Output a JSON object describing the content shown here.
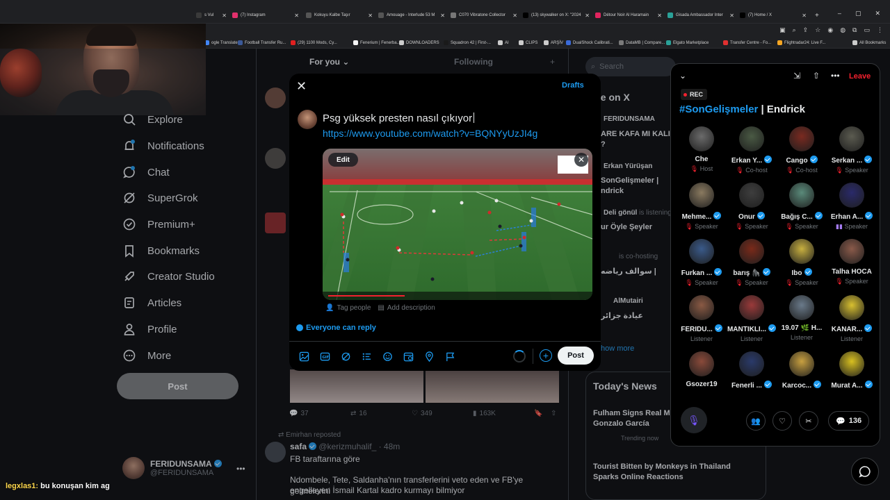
{
  "browser": {
    "tabs": [
      {
        "label": "s Vul",
        "color": "#3a3a3a"
      },
      {
        "label": "(7) Instagram",
        "color": "#e1306c"
      },
      {
        "label": "Kokuyu Kalbe Taşır",
        "color": "#555555"
      },
      {
        "label": "Amouage - Interlude 53 M",
        "color": "#555555"
      },
      {
        "label": "C070 Vibratone Collector",
        "color": "#777777"
      },
      {
        "label": "(13) skywalker on X: \"2024",
        "color": "#000000"
      },
      {
        "label": "Détour Noir Al Haramain",
        "color": "#e0245e"
      },
      {
        "label": "Gisada Ambassador Inter",
        "color": "#2aa198"
      },
      {
        "label": "(7) Home / X",
        "color": "#000000"
      }
    ],
    "bookmarks": [
      "ogle Translate",
      "Football Transfer Ru...",
      "(29) 1100 Mods, Cy...",
      "Fenerium | Fenerba...",
      "DOWNLOADERS",
      "Squadron 42 | First-...",
      "AI",
      "CLIPS",
      "ARŞİV",
      "DualShock Calibrati...",
      "DataMB | Compare...",
      "Elgato Marketplace",
      "Transfer Centre - Fo...",
      "Flightradar24: Live F...",
      "All Bookmarks"
    ]
  },
  "nav": {
    "items": [
      {
        "id": "explore",
        "label": "Explore"
      },
      {
        "id": "notifications",
        "label": "Notifications"
      },
      {
        "id": "chat",
        "label": "Chat"
      },
      {
        "id": "supergrok",
        "label": "SuperGrok"
      },
      {
        "id": "premium",
        "label": "Premium+"
      },
      {
        "id": "bookmarks",
        "label": "Bookmarks"
      },
      {
        "id": "creator",
        "label": "Creator Studio"
      },
      {
        "id": "articles",
        "label": "Articles"
      },
      {
        "id": "profile",
        "label": "Profile"
      },
      {
        "id": "more",
        "label": "More"
      }
    ],
    "post_label": "Post",
    "account_name": "FERIDUNSAMA",
    "account_handle": "@FERIDUNSAMA"
  },
  "feed": {
    "tab_for_you": "For you",
    "tab_following": "Following",
    "actions": {
      "replies": "37",
      "reposts": "16",
      "likes": "349",
      "views": "163K"
    },
    "reposted_by": "Emirhan reposted",
    "tweet2_name": "safa",
    "tweet2_handle": "@kerizmuhalif_ · 48m",
    "tweet2_line1": "FB taraftarına göre",
    "tweet2_line2": "Ndombele, Tete, Saldanha'nın transferlerini veto eden ve FB'ye gelmelerini",
    "tweet2_line3": "engelleyen İsmail Kartal kadro kurmayı bilmiyor"
  },
  "right": {
    "search_placeholder": "Search",
    "live_title": "ve on X",
    "live_1_name": "FERIDUNSAMA",
    "live_1_text": "ARE KAFA MI KALIN",
    "live_1_text2": "?",
    "live_2_name": "Erkan Yürüşan",
    "live_2_text": "SonGelişmeler |",
    "live_2_text2": "ndrick",
    "live_3_name": "Deli gönül",
    "live_3_status": "is listening",
    "live_3_text": "ur Öyle Şeyler",
    "live_4_status": "is co-hosting",
    "live_4_text": "سوالف رياضه |",
    "live_5_name": "AlMutairi",
    "live_5_text": "عيادة جزائر",
    "show_more": "how more",
    "news_title": "Today's News",
    "news_1": "Fulham Signs Real M",
    "news_1b": "Gonzalo García",
    "news_1_meta": "Trending now",
    "news_2": "Tourist Bitten by Monkeys in Thailand",
    "news_2b": "Sparks Online Reactions"
  },
  "compose": {
    "drafts_label": "Drafts",
    "text": "Psg yüksek presten nasıl çıkıyor",
    "link": "https://www.youtube.com/watch?v=BQNYyUzJI4g",
    "edit_label": "Edit",
    "tag_people": "Tag people",
    "add_description": "Add description",
    "reply_setting": "Everyone can reply",
    "post_label": "Post"
  },
  "space": {
    "rec_label": "REC",
    "hashtag": "#SonGelişmeler",
    "title_rest": " | Endrick",
    "leave_label": "Leave",
    "comments_count": "136",
    "speakers": [
      {
        "name": "Che",
        "role": "Host",
        "verified": false,
        "color": "#6b6b6b"
      },
      {
        "name": "Erkan Y...",
        "role": "Co-host",
        "verified": true,
        "color": "#4a5a44"
      },
      {
        "name": "Cango",
        "role": "Co-host",
        "verified": true,
        "color": "#7a2a20"
      },
      {
        "name": "Serkan ...",
        "role": "Speaker",
        "verified": true,
        "color": "#5b5b50"
      },
      {
        "name": "Mehme...",
        "role": "Speaker",
        "verified": true,
        "color": "#8a7a60"
      },
      {
        "name": "Onur",
        "role": "Speaker",
        "verified": true,
        "color": "#3e3e3e"
      },
      {
        "name": "Bağış C...",
        "role": "Speaker",
        "verified": true,
        "color": "#5a8a7a"
      },
      {
        "name": "Erhan A...",
        "role": "Speaker",
        "verified": true,
        "color": "#2a2a6a"
      },
      {
        "name": "Furkan ...",
        "role": "Speaker",
        "verified": true,
        "color": "#3a5a8a"
      },
      {
        "name": "barış 🦍",
        "role": "Speaker",
        "verified": true,
        "color": "#7a2a1a"
      },
      {
        "name": "Ibo",
        "role": "Speaker",
        "verified": true,
        "color": "#c8b040"
      },
      {
        "name": "Talha HOCA",
        "role": "Speaker",
        "verified": false,
        "color": "#8a5a4a"
      },
      {
        "name": "FERIDU...",
        "role": "Listener",
        "verified": true,
        "color": "#8a5a44"
      },
      {
        "name": "MANTIKLI...",
        "role": "Listener",
        "verified": true,
        "color": "#9a3a3a"
      },
      {
        "name": "19.07 🌿 H...",
        "role": "Listener",
        "verified": false,
        "color": "#6a7a8a"
      },
      {
        "name": "KANAR...",
        "role": "Listener",
        "verified": true,
        "color": "#d8c030"
      },
      {
        "name": "Gsozer19",
        "role": "",
        "verified": false,
        "color": "#8a4a3a"
      },
      {
        "name": "Fenerli ...",
        "role": "",
        "verified": true,
        "color": "#2a3a6a"
      },
      {
        "name": "Karcoc...",
        "role": "",
        "verified": true,
        "color": "#c8a040"
      },
      {
        "name": "Murat A...",
        "role": "",
        "verified": true,
        "color": "#d8c020"
      }
    ]
  },
  "chat_overlay": {
    "user": "legxlas1:",
    "message": "bu konuşan kim ag"
  },
  "colors": {
    "accent": "#1d9bf0",
    "danger": "#f4212e",
    "background": "#000000"
  }
}
